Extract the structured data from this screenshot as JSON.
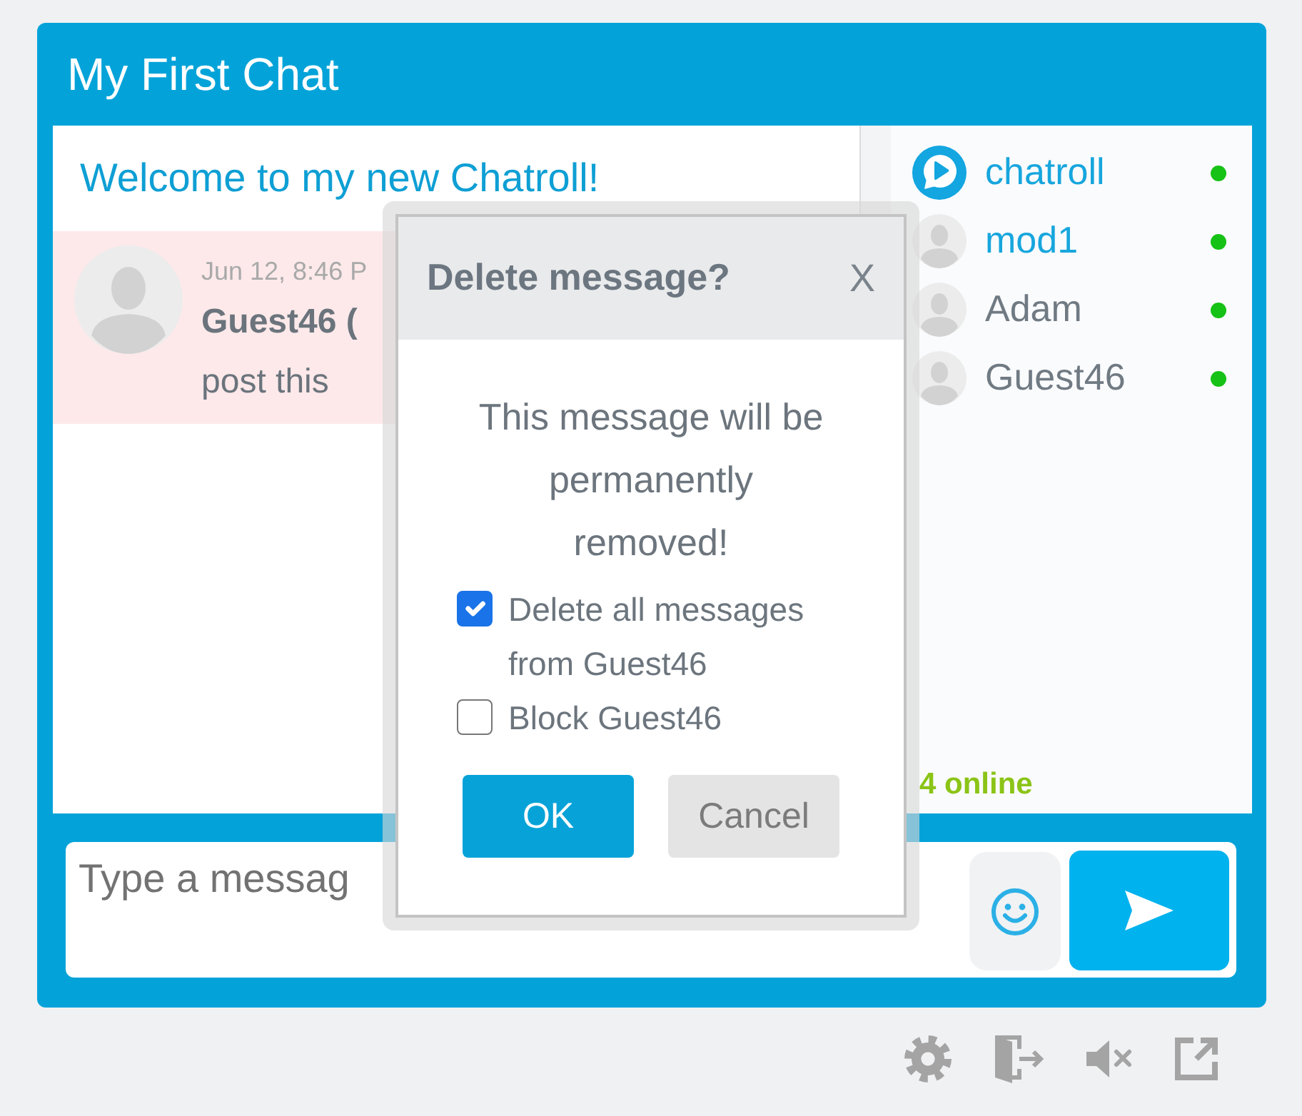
{
  "window": {
    "title": "My First Chat"
  },
  "welcome": "Welcome to my new Chatroll!",
  "messages": [
    {
      "time": "Jun 12, 8:46 P",
      "author": "Guest46 (",
      "text": "post this",
      "selected": true
    }
  ],
  "users": [
    {
      "name": "chatroll",
      "kind": "logo",
      "highlighted": true,
      "online": true
    },
    {
      "name": "mod1",
      "kind": "avatar",
      "highlighted": true,
      "online": true
    },
    {
      "name": "Adam",
      "kind": "avatar",
      "highlighted": false,
      "online": true
    },
    {
      "name": "Guest46",
      "kind": "avatar",
      "highlighted": false,
      "online": true
    }
  ],
  "online_count": "4 online",
  "composer": {
    "placeholder": "Type a messag"
  },
  "dialog": {
    "title": "Delete message?",
    "close": "X",
    "message": "This message will be permanently removed!",
    "options": [
      {
        "label": "Delete all messages from Guest46",
        "checked": true
      },
      {
        "label": "Block Guest46",
        "checked": false
      }
    ],
    "buttons": [
      {
        "label": "OK",
        "kind": "primary"
      },
      {
        "label": "Cancel",
        "kind": "secondary"
      }
    ]
  }
}
